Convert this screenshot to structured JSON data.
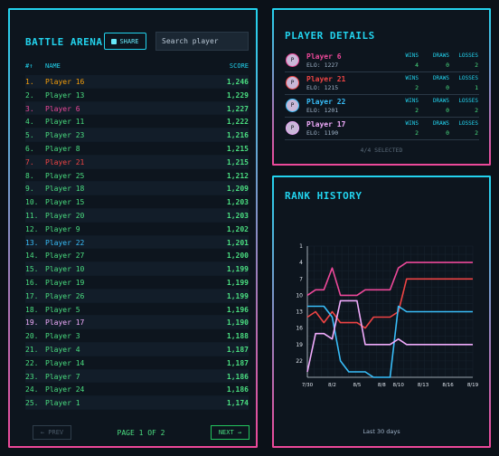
{
  "leaderboard": {
    "title": "BATTLE ARENA",
    "share_label": "SHARE",
    "search_placeholder": "Search player",
    "col_rank": "#↑",
    "col_name": "NAME",
    "col_score": "SCORE",
    "rows": [
      {
        "rank": "1.",
        "name": "Player 16",
        "score": "1,246",
        "color": "#f59e0b"
      },
      {
        "rank": "2.",
        "name": "Player 13",
        "score": "1,229",
        "color": "#4ade80"
      },
      {
        "rank": "3.",
        "name": "Player 6",
        "score": "1,227",
        "color": "#ec4899"
      },
      {
        "rank": "4.",
        "name": "Player 11",
        "score": "1,222",
        "color": "#4ade80"
      },
      {
        "rank": "5.",
        "name": "Player 23",
        "score": "1,216",
        "color": "#4ade80"
      },
      {
        "rank": "6.",
        "name": "Player 8",
        "score": "1,215",
        "color": "#4ade80"
      },
      {
        "rank": "7.",
        "name": "Player 21",
        "score": "1,215",
        "color": "#ef4444"
      },
      {
        "rank": "8.",
        "name": "Player 25",
        "score": "1,212",
        "color": "#4ade80"
      },
      {
        "rank": "9.",
        "name": "Player 18",
        "score": "1,209",
        "color": "#4ade80"
      },
      {
        "rank": "10.",
        "name": "Player 15",
        "score": "1,203",
        "color": "#4ade80"
      },
      {
        "rank": "11.",
        "name": "Player 20",
        "score": "1,203",
        "color": "#4ade80"
      },
      {
        "rank": "12.",
        "name": "Player 9",
        "score": "1,202",
        "color": "#4ade80"
      },
      {
        "rank": "13.",
        "name": "Player 22",
        "score": "1,201",
        "color": "#38bdf8"
      },
      {
        "rank": "14.",
        "name": "Player 27",
        "score": "1,200",
        "color": "#4ade80"
      },
      {
        "rank": "15.",
        "name": "Player 10",
        "score": "1,199",
        "color": "#4ade80"
      },
      {
        "rank": "16.",
        "name": "Player 19",
        "score": "1,199",
        "color": "#4ade80"
      },
      {
        "rank": "17.",
        "name": "Player 26",
        "score": "1,199",
        "color": "#4ade80"
      },
      {
        "rank": "18.",
        "name": "Player 5",
        "score": "1,196",
        "color": "#4ade80"
      },
      {
        "rank": "19.",
        "name": "Player 17",
        "score": "1,190",
        "color": "#f0abfc"
      },
      {
        "rank": "20.",
        "name": "Player 3",
        "score": "1,188",
        "color": "#4ade80"
      },
      {
        "rank": "21.",
        "name": "Player 4",
        "score": "1,187",
        "color": "#4ade80"
      },
      {
        "rank": "22.",
        "name": "Player 14",
        "score": "1,187",
        "color": "#4ade80"
      },
      {
        "rank": "23.",
        "name": "Player 7",
        "score": "1,186",
        "color": "#4ade80"
      },
      {
        "rank": "24.",
        "name": "Player 24",
        "score": "1,186",
        "color": "#4ade80"
      },
      {
        "rank": "25.",
        "name": "Player 1",
        "score": "1,174",
        "color": "#4ade80"
      }
    ],
    "prev_label": "← PREV",
    "page_info": "PAGE 1 OF 2",
    "next_label": "NEXT →"
  },
  "details": {
    "title": "PLAYER DETAILS",
    "wins_label": "WINS",
    "draws_label": "DRAWS",
    "losses_label": "LOSSES",
    "avatar_letter": "P",
    "players": [
      {
        "name": "Player 6",
        "elo": "ELO: 1227",
        "wins": "4",
        "draws": "0",
        "losses": "2",
        "color": "#ec4899"
      },
      {
        "name": "Player 21",
        "elo": "ELO: 1215",
        "wins": "2",
        "draws": "0",
        "losses": "1",
        "color": "#ef4444"
      },
      {
        "name": "Player 22",
        "elo": "ELO: 1201",
        "wins": "2",
        "draws": "0",
        "losses": "2",
        "color": "#38bdf8"
      },
      {
        "name": "Player 17",
        "elo": "ELO: 1190",
        "wins": "2",
        "draws": "0",
        "losses": "2",
        "color": "#f0abfc"
      }
    ],
    "selected_text": "4/4 SELECTED"
  },
  "history": {
    "title": "RANK HISTORY",
    "footer": "Last 30 days"
  },
  "chart_data": {
    "type": "line",
    "title": "RANK HISTORY",
    "x": [
      "7/30",
      "7/31",
      "8/1",
      "8/2",
      "8/3",
      "8/4",
      "8/5",
      "8/6",
      "8/7",
      "8/8",
      "8/9",
      "8/10",
      "8/11",
      "8/12",
      "8/13",
      "8/14",
      "8/15",
      "8/16",
      "8/17",
      "8/18",
      "8/19"
    ],
    "x_tick_labels": [
      "7/30",
      "8/2",
      "8/5",
      "8/8",
      "8/10",
      "8/13",
      "8/16",
      "8/19"
    ],
    "y_ticks": [
      1,
      4,
      7,
      10,
      13,
      16,
      19,
      22
    ],
    "ylim": [
      1,
      25
    ],
    "y_inverted": true,
    "series": [
      {
        "name": "Player 6",
        "color": "#ec4899",
        "values": [
          10,
          9,
          9,
          5,
          10,
          10,
          10,
          9,
          9,
          9,
          9,
          5,
          4,
          4,
          4,
          4,
          4,
          4,
          4,
          4,
          4
        ]
      },
      {
        "name": "Player 21",
        "color": "#ef4444",
        "values": [
          14,
          13,
          15,
          13,
          15,
          15,
          15,
          16,
          14,
          14,
          14,
          13,
          7,
          7,
          7,
          7,
          7,
          7,
          7,
          7,
          7
        ]
      },
      {
        "name": "Player 22",
        "color": "#38bdf8",
        "values": [
          12,
          12,
          12,
          14,
          22,
          24,
          24,
          24,
          25,
          25,
          25,
          12,
          13,
          13,
          13,
          13,
          13,
          13,
          13,
          13,
          13
        ]
      },
      {
        "name": "Player 17",
        "color": "#f0abfc",
        "values": [
          24,
          17,
          17,
          18,
          11,
          11,
          11,
          19,
          19,
          19,
          19,
          18,
          19,
          19,
          19,
          19,
          19,
          19,
          19,
          19,
          19
        ]
      }
    ]
  }
}
